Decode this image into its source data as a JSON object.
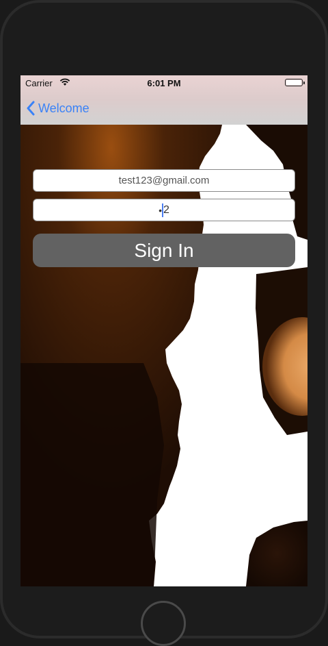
{
  "status_bar": {
    "carrier": "Carrier",
    "time": "6:01 PM",
    "battery_level": 1.0
  },
  "nav": {
    "back_label": "Welcome",
    "back_icon": "chevron-left-icon"
  },
  "form": {
    "email_value": "test123@gmail.com",
    "password_mask": "•",
    "password_last_char": "2",
    "signin_label": "Sign In"
  },
  "colors": {
    "accent": "#3a82f7",
    "button_bg": "#626262"
  }
}
